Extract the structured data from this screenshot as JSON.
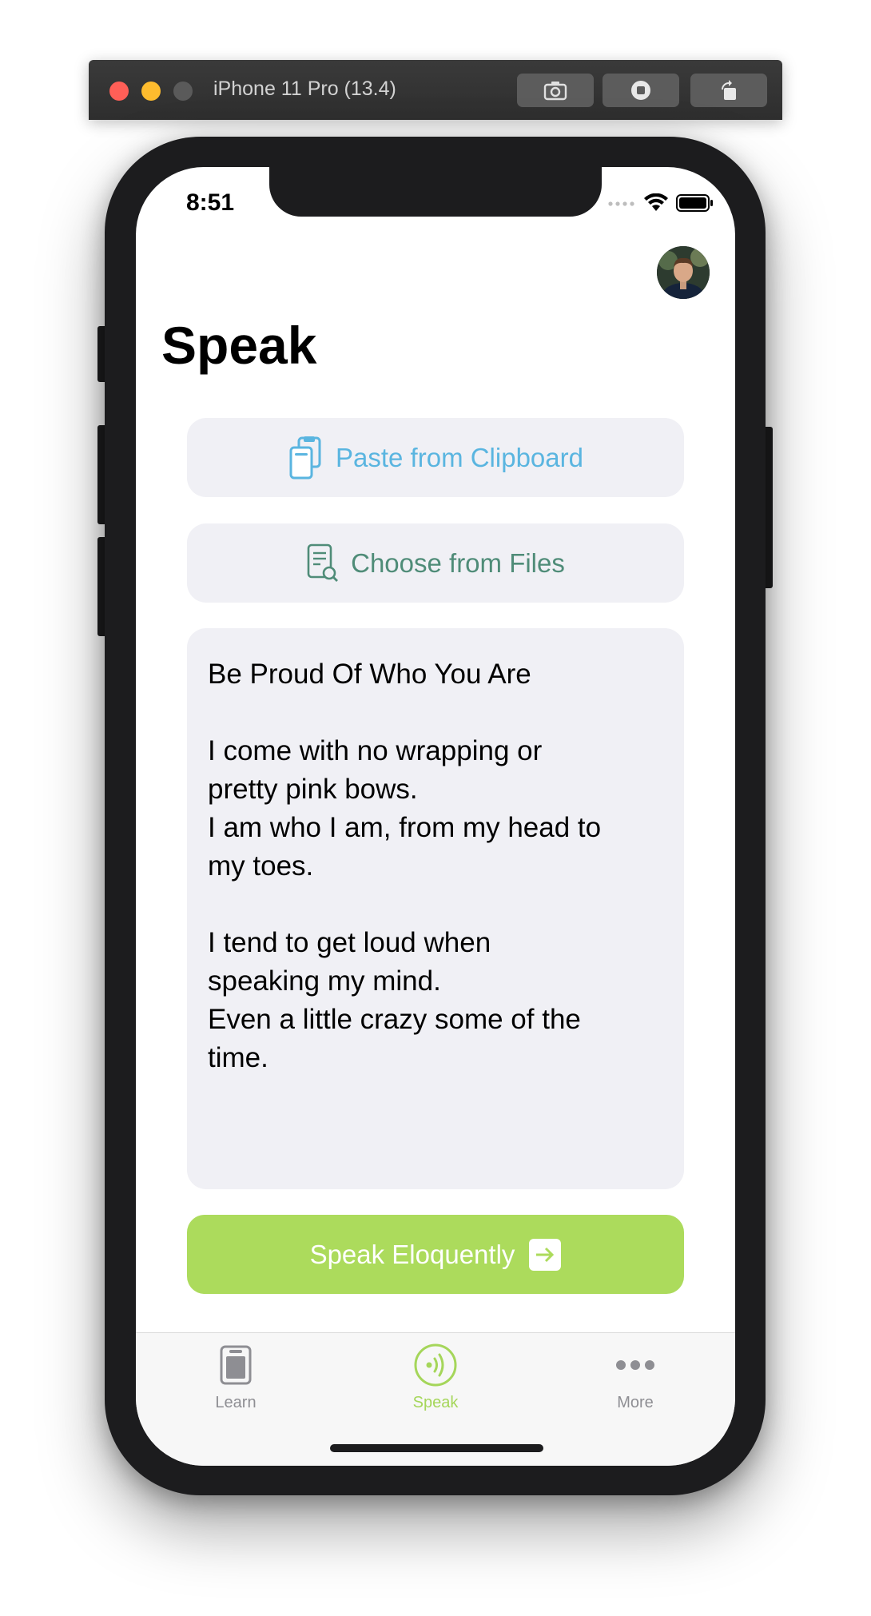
{
  "simulator": {
    "title": "iPhone 11 Pro (13.4)"
  },
  "status_bar": {
    "time": "8:51"
  },
  "page": {
    "title": "Speak"
  },
  "actions": {
    "paste_label": "Paste from Clipboard",
    "files_label": "Choose from Files",
    "speak_label": "Speak Eloquently"
  },
  "text_content": {
    "line1": "Be Proud Of Who You Are",
    "line2": "I come with no wrapping or",
    "line3": "pretty pink bows.",
    "line4": "I am who I am, from my head to",
    "line5": "my toes.",
    "line6": "I tend to get loud when",
    "line7": "speaking my mind.",
    "line8": "Even a little crazy some of the",
    "line9": "time."
  },
  "tabs": {
    "learn": "Learn",
    "speak": "Speak",
    "more": "More"
  },
  "colors": {
    "accent_green": "#acdb5c",
    "paste_blue": "#5ab5e0",
    "files_green": "#4f8c78",
    "tab_inactive": "#8e8e93"
  },
  "icons": {
    "paste": "clipboard-icon",
    "files": "document-search-icon",
    "speak_arrow": "arrow-right-icon",
    "tab_learn": "book-icon",
    "tab_speak": "broadcast-icon",
    "tab_more": "ellipsis-icon"
  }
}
